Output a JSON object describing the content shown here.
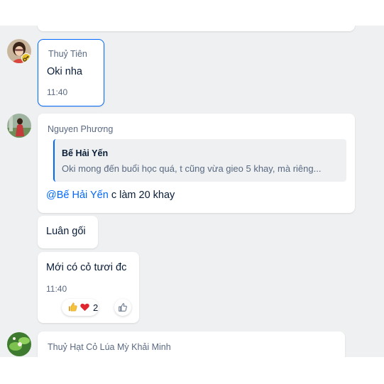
{
  "messages": [
    {
      "sender": "Thuỷ Tiên",
      "text": "Oki nha",
      "time": "11:40"
    },
    {
      "sender": "Nguyen Phương",
      "quote": {
        "author": "Bế Hải Yến",
        "text": "Oki mong đến buổi học quá, t cũng vừa gieo 5 khay, mà riêng..."
      },
      "mention": "@Bế Hải Yến",
      "text": " c làm 20 khay"
    },
    {
      "text": "Luân gối"
    },
    {
      "text": "Mới có cỏ tươi đc",
      "time": "11:40",
      "reactions": {
        "icons": [
          "thumbs-up-emoji",
          "heart-emoji"
        ],
        "count": "2"
      }
    },
    {
      "sender": "Thuỷ Hạt Cỏ Lúa Mỳ Khải Minh"
    }
  ],
  "colors": {
    "chat_background": "#eef0f1",
    "selected_border": "#0068ff",
    "mention": "#0068ff"
  }
}
